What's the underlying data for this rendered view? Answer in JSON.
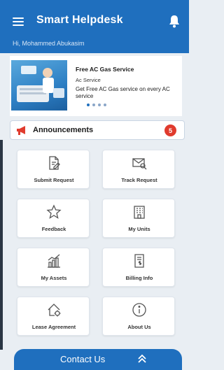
{
  "header": {
    "title": "Smart Helpdesk",
    "greeting": "Hi, Mohammed Abukasim",
    "menu_icon": "hamburger-menu-icon",
    "notification_icon": "bell-icon"
  },
  "promo": {
    "title": "Free AC Gas Service",
    "category": "Ac Service",
    "description": "Get Free AC Gas service on every AC service",
    "slides": 4,
    "active_slide": 1
  },
  "announcements": {
    "label": "Announcements",
    "count": "5"
  },
  "tiles": [
    {
      "label": "Submit Request",
      "icon": "document-edit-icon"
    },
    {
      "label": "Track Request",
      "icon": "mail-search-icon"
    },
    {
      "label": "Feedback",
      "icon": "star-icon"
    },
    {
      "label": "My Units",
      "icon": "building-icon"
    },
    {
      "label": "My Assets",
      "icon": "chart-icon"
    },
    {
      "label": "Billing Info",
      "icon": "invoice-icon"
    },
    {
      "label": "Lease Agreement",
      "icon": "home-settings-icon"
    },
    {
      "label": "About Us",
      "icon": "info-icon"
    }
  ],
  "footer": {
    "contact_label": "Contact Us",
    "expand_icon": "chevron-up-icon"
  },
  "colors": {
    "primary": "#1f6fbe",
    "badge": "#e03b2e",
    "background": "#e9eef3"
  }
}
